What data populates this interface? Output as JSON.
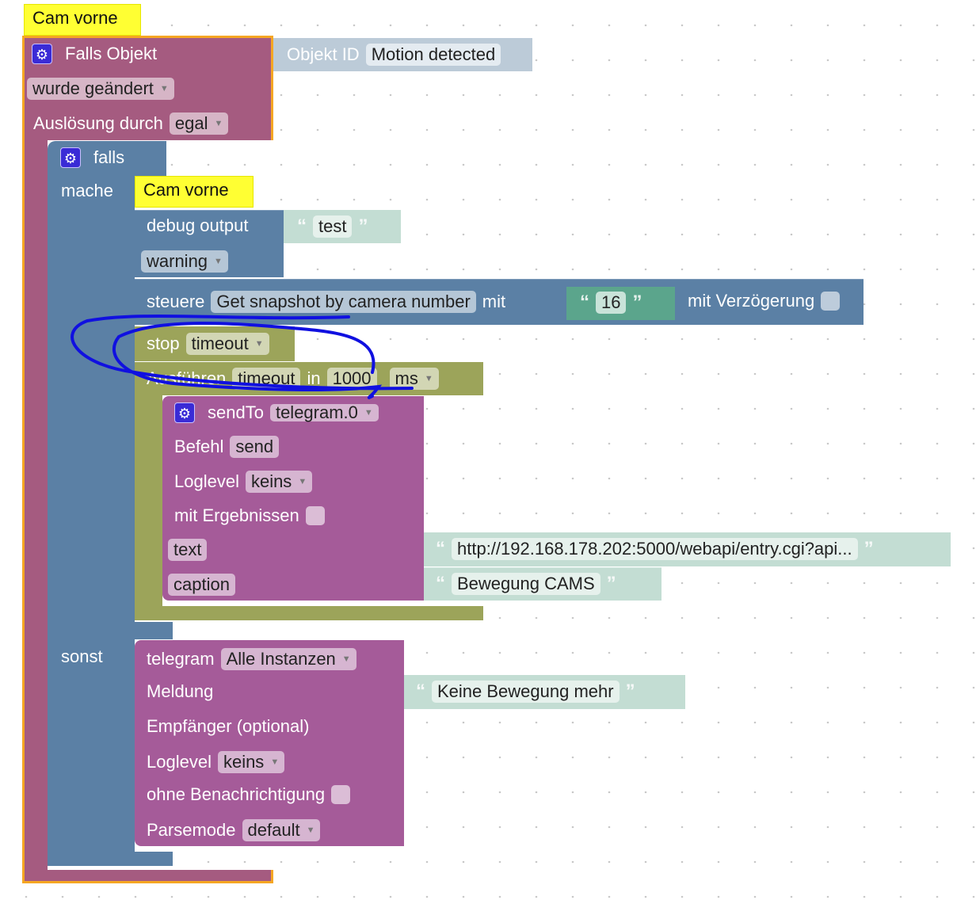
{
  "event": {
    "comment": "Cam vorne",
    "title": "Falls Objekt",
    "trigger": "wurde geändert",
    "ausloesung_label": "Auslösung durch",
    "ausloesung_value": "egal",
    "objekt_id_label": "Objekt ID",
    "objekt_id_value": "Motion detected"
  },
  "if_block": {
    "falls": "falls",
    "mache": "mache",
    "sonst": "sonst"
  },
  "debug": {
    "comment": "Cam vorne",
    "label": "debug output",
    "text": "test",
    "level": "warning"
  },
  "control": {
    "label": "steuere",
    "target": "Get snapshot by camera number",
    "mit": "mit",
    "value": "16",
    "delay_label": "mit Verzögerung"
  },
  "stop": {
    "label": "stop",
    "value": "timeout"
  },
  "timeout": {
    "label": "Ausführen",
    "name": "timeout",
    "in": "in",
    "value": "1000",
    "unit": "ms"
  },
  "sendto": {
    "label": "sendTo",
    "instance": "telegram.0",
    "befehl_label": "Befehl",
    "befehl": "send",
    "loglevel_label": "Loglevel",
    "loglevel": "keins",
    "ergebnisse_label": "mit Ergebnissen",
    "text_label": "text",
    "text_value": "http://192.168.178.202:5000/webapi/entry.cgi?api...",
    "caption_label": "caption",
    "caption_value": "Bewegung CAMS"
  },
  "telegram": {
    "label": "telegram",
    "instance": "Alle Instanzen",
    "meldung_label": "Meldung",
    "meldung": "Keine Bewegung mehr",
    "empfaenger_label": "Empfänger (optional)",
    "loglevel_label": "Loglevel",
    "loglevel": "keins",
    "ohne_label": "ohne Benachrichtigung",
    "parsemode_label": "Parsemode",
    "parsemode": "default"
  },
  "colors": {
    "event": "#a55b80",
    "logic": "#5b80a5",
    "timeout": "#9ca45a",
    "sendto": "#a55b99",
    "text": "#c3ddd3",
    "number": "#5ba58c",
    "highlight": "#f5a623",
    "annotation": "#1010e0"
  }
}
